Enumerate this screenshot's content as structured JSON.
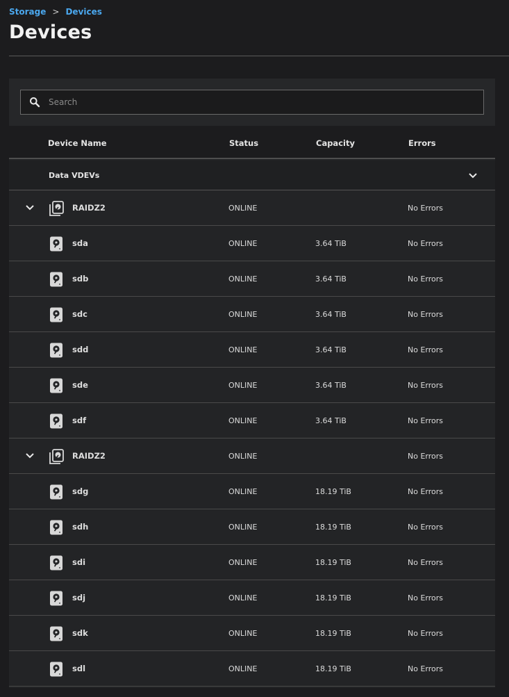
{
  "breadcrumb": {
    "items": [
      "Storage",
      "Devices"
    ],
    "separator": ">"
  },
  "page": {
    "title": "Devices"
  },
  "search": {
    "placeholder": "Search",
    "value": ""
  },
  "columns": {
    "name": "Device Name",
    "status": "Status",
    "capacity": "Capacity",
    "errors": "Errors"
  },
  "group": {
    "label": "Data VDEVs"
  },
  "colors": {
    "accent": "#4aa7ee",
    "background": "#1c1c1e",
    "panel": "#232426"
  },
  "rows": [
    {
      "kind": "vdev",
      "name": "RAIDZ2",
      "status": "ONLINE",
      "capacity": "",
      "errors": "No Errors",
      "icon": "raidz-icon"
    },
    {
      "kind": "disk",
      "name": "sda",
      "status": "ONLINE",
      "capacity": "3.64 TiB",
      "errors": "No Errors",
      "icon": "hard-disk-icon"
    },
    {
      "kind": "disk",
      "name": "sdb",
      "status": "ONLINE",
      "capacity": "3.64 TiB",
      "errors": "No Errors",
      "icon": "hard-disk-icon"
    },
    {
      "kind": "disk",
      "name": "sdc",
      "status": "ONLINE",
      "capacity": "3.64 TiB",
      "errors": "No Errors",
      "icon": "hard-disk-icon"
    },
    {
      "kind": "disk",
      "name": "sdd",
      "status": "ONLINE",
      "capacity": "3.64 TiB",
      "errors": "No Errors",
      "icon": "hard-disk-icon"
    },
    {
      "kind": "disk",
      "name": "sde",
      "status": "ONLINE",
      "capacity": "3.64 TiB",
      "errors": "No Errors",
      "icon": "hard-disk-icon"
    },
    {
      "kind": "disk",
      "name": "sdf",
      "status": "ONLINE",
      "capacity": "3.64 TiB",
      "errors": "No Errors",
      "icon": "hard-disk-icon"
    },
    {
      "kind": "vdev",
      "name": "RAIDZ2",
      "status": "ONLINE",
      "capacity": "",
      "errors": "No Errors",
      "icon": "raidz-icon"
    },
    {
      "kind": "disk",
      "name": "sdg",
      "status": "ONLINE",
      "capacity": "18.19 TiB",
      "errors": "No Errors",
      "icon": "hard-disk-icon"
    },
    {
      "kind": "disk",
      "name": "sdh",
      "status": "ONLINE",
      "capacity": "18.19 TiB",
      "errors": "No Errors",
      "icon": "hard-disk-icon"
    },
    {
      "kind": "disk",
      "name": "sdi",
      "status": "ONLINE",
      "capacity": "18.19 TiB",
      "errors": "No Errors",
      "icon": "hard-disk-icon"
    },
    {
      "kind": "disk",
      "name": "sdj",
      "status": "ONLINE",
      "capacity": "18.19 TiB",
      "errors": "No Errors",
      "icon": "hard-disk-icon"
    },
    {
      "kind": "disk",
      "name": "sdk",
      "status": "ONLINE",
      "capacity": "18.19 TiB",
      "errors": "No Errors",
      "icon": "hard-disk-icon"
    },
    {
      "kind": "disk",
      "name": "sdl",
      "status": "ONLINE",
      "capacity": "18.19 TiB",
      "errors": "No Errors",
      "icon": "hard-disk-icon"
    }
  ]
}
